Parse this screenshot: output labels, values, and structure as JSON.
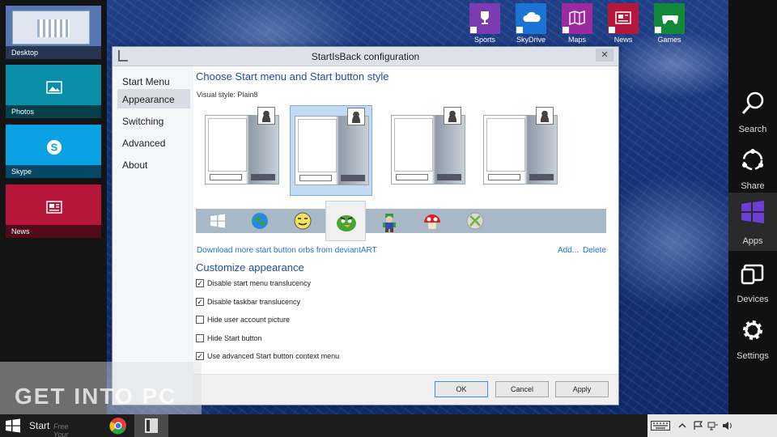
{
  "window_title": "StartIsBack configuration",
  "close_glyph": "✕",
  "sidebar": {
    "items": [
      {
        "label": "Start Menu",
        "active": false
      },
      {
        "label": "Appearance",
        "active": true
      },
      {
        "label": "Switching",
        "active": false
      },
      {
        "label": "Advanced",
        "active": false
      },
      {
        "label": "About",
        "active": false
      }
    ]
  },
  "main": {
    "heading": "Choose Start menu and Start button style",
    "visual_style_label": "Visual style:",
    "visual_style_value": "Plain8",
    "selected_style_index": 1,
    "style_count": 4,
    "orbs": [
      "windows-logo-orb",
      "globe-orb",
      "smiley-orb",
      "green-bird-orb",
      "luigi-orb",
      "mushroom-orb",
      "xbox-orb"
    ],
    "selected_orb_index": 3,
    "download_link": "Download more start button orbs from deviantART",
    "add_link": "Add...",
    "delete_link": "Delete",
    "customize_heading": "Customize appearance",
    "options": [
      {
        "label": "Disable start menu translucency",
        "checked": true
      },
      {
        "label": "Disable taskbar translucency",
        "checked": true
      },
      {
        "label": "Hide user account picture",
        "checked": false
      },
      {
        "label": "Hide Start button",
        "checked": false
      },
      {
        "label": "Use advanced Start button context menu",
        "checked": true
      }
    ]
  },
  "buttons": {
    "ok": "OK",
    "cancel": "Cancel",
    "apply": "Apply"
  },
  "switcher": {
    "apps": [
      {
        "label": "Desktop",
        "color": "#5578b5"
      },
      {
        "label": "Photos",
        "color": "#0b8fa8"
      },
      {
        "label": "Skype",
        "color": "#0aa1e2"
      },
      {
        "label": "News",
        "color": "#b5163a"
      }
    ]
  },
  "top_tiles": [
    {
      "label": "Sports",
      "color": "#7a3cb0"
    },
    {
      "label": "SkyDrive",
      "color": "#1a74d4"
    },
    {
      "label": "Maps",
      "color": "#9b2aa0"
    },
    {
      "label": "News",
      "color": "#b5163a"
    },
    {
      "label": "Games",
      "color": "#108a3a"
    }
  ],
  "charms": [
    {
      "label": "Search"
    },
    {
      "label": "Share"
    },
    {
      "label": "Apps",
      "accent": "#6b3fd6"
    },
    {
      "label": "Devices"
    },
    {
      "label": "Settings"
    }
  ],
  "watermark": "GET INTO PC",
  "taskbar": {
    "start_label": "Start",
    "watermark_tag": "Free Your Desires"
  }
}
